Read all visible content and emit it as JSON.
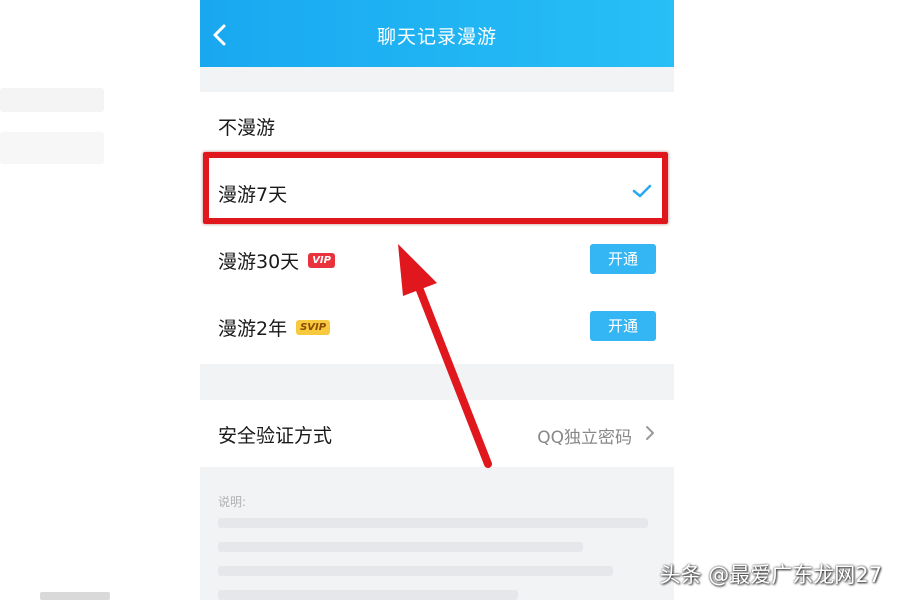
{
  "nav": {
    "title": "聊天记录漫游",
    "back_icon": "chevron-left-icon"
  },
  "roam_options": {
    "no_roam": "不漫游",
    "seven_days": "漫游7天",
    "thirty_days": "漫游30天",
    "thirty_days_badge": "VIP",
    "two_years": "漫游2年",
    "two_years_badge": "SVIP",
    "open_label": "开通",
    "selected_icon": "check-icon"
  },
  "security": {
    "label": "安全验证方式",
    "value": "QQ独立密码",
    "chevron_icon": "chevron-right-icon"
  },
  "notes": {
    "title": "说明:"
  },
  "watermark": "头条 @最爱广东龙网27",
  "colors": {
    "nav_gradient_start": "#19a8f0",
    "nav_gradient_end": "#27bff6",
    "open_button": "#33b6f3",
    "vip_badge": "#e9323c",
    "svip_badge": "#f7c93e",
    "check": "#2aa8ef",
    "annotation_red": "#e0171d"
  }
}
